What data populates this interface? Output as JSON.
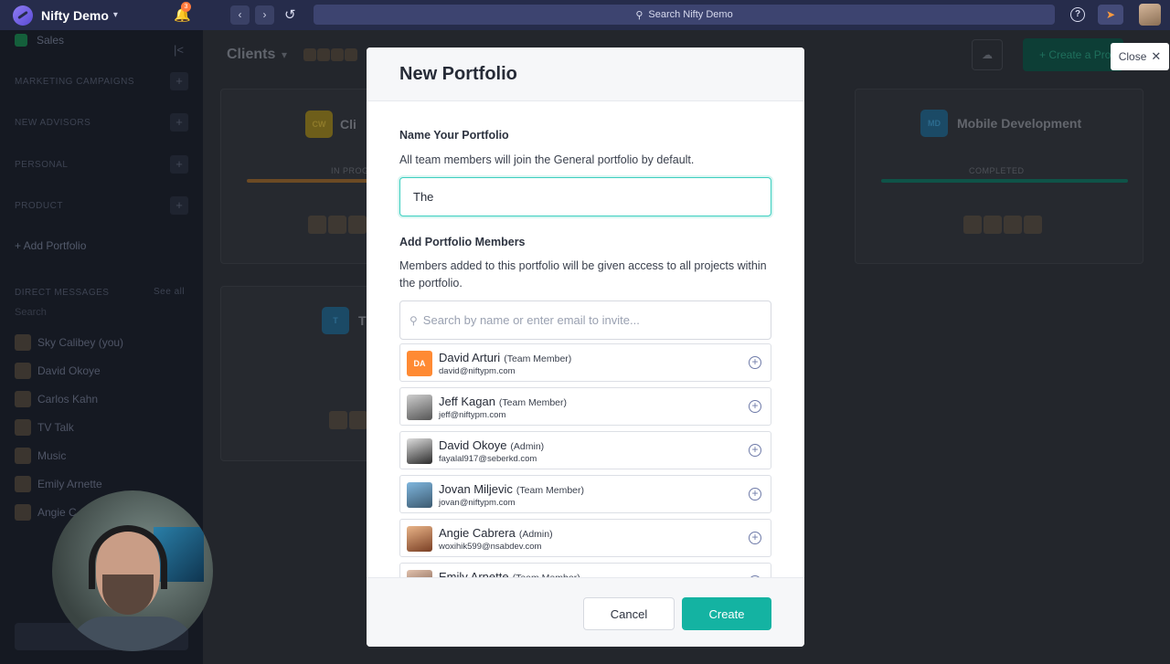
{
  "topbar": {
    "app_name": "Nifty Demo",
    "notification_count": "3",
    "search_label": "Search Nifty Demo"
  },
  "sidebar": {
    "sales": "Sales",
    "sections": [
      "MARKETING CAMPAIGNS",
      "NEW ADVISORS",
      "PERSONAL",
      "PRODUCT"
    ],
    "add_portfolio": "+ Add Portfolio",
    "direct_messages": "DIRECT MESSAGES",
    "see_all": "See all",
    "dm_search": "Search",
    "dms": [
      "Sky Calibey (you)",
      "David Okoye",
      "Carlos Kahn",
      "TV Talk",
      "Music",
      "Emily Arnette",
      "Angie C"
    ]
  },
  "main": {
    "title": "Clients",
    "create_label": "+ Create a Project",
    "cards": [
      {
        "badge": "CW",
        "name": "Cli",
        "status": "IN PROG"
      },
      {
        "badge": "MD",
        "name": "Mobile Development",
        "status": "COMPLETED"
      },
      {
        "badge": "T",
        "name": "T",
        "status": ""
      }
    ]
  },
  "close_chip": {
    "label": "Close"
  },
  "modal": {
    "title": "New Portfolio",
    "name_section_title": "Name Your Portfolio",
    "name_section_desc": "All team members will join the General portfolio by default.",
    "name_input_value": "The",
    "members_section_title": "Add Portfolio Members",
    "members_section_desc": "Members added to this portfolio will be given access to all projects within the portfolio.",
    "search_placeholder": "Search by name or enter email to invite...",
    "members": [
      {
        "name": "David Arturi",
        "role": "(Team Member)",
        "email": "david@niftypm.com",
        "initials": "DA"
      },
      {
        "name": "Jeff Kagan",
        "role": "(Team Member)",
        "email": "jeff@niftypm.com",
        "initials": ""
      },
      {
        "name": "David Okoye",
        "role": "(Admin)",
        "email": "fayalal917@seberkd.com",
        "initials": ""
      },
      {
        "name": "Jovan Miljevic",
        "role": "(Team Member)",
        "email": "jovan@niftypm.com",
        "initials": ""
      },
      {
        "name": "Angie Cabrera",
        "role": "(Admin)",
        "email": "woxihik599@nsabdev.com",
        "initials": ""
      },
      {
        "name": "Emily Arnette",
        "role": "(Team Member)",
        "email": "",
        "initials": ""
      }
    ],
    "cancel_label": "Cancel",
    "create_label": "Create"
  },
  "colors": {
    "accent_teal": "#14b3a2",
    "topbar": "#262c4b",
    "initials_avatar": "#ff8a33"
  }
}
